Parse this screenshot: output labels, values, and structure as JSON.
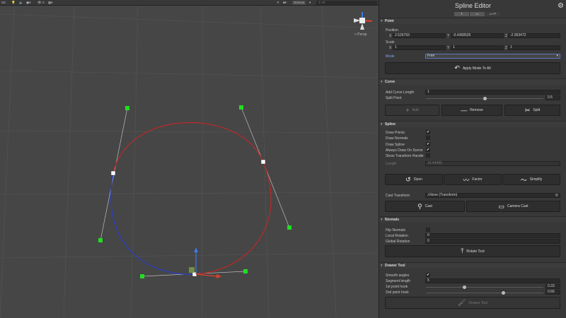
{
  "scene": {
    "toolbar": {
      "gizmos": "Gizmos",
      "search_placeholder": "All",
      "count": "0"
    },
    "persp": "< Persp"
  },
  "inspector": {
    "title": "Spline Editor",
    "tabs": [
      "T",
      "▭",
      "▭+T"
    ],
    "point": {
      "header": "Point",
      "position_label": "Position",
      "position": {
        "x": "2.526793",
        "y": "-0.4368526",
        "z": "-2.953472"
      },
      "scale_label": "Scale",
      "scale": {
        "x": "1",
        "y": "1",
        "z": "1"
      },
      "mode_label": "Mode",
      "mode_value": "Free",
      "apply_label": "Apply Mode To All"
    },
    "curve": {
      "header": "Curve",
      "add_length_label": "Add Curve Length",
      "add_length": "1",
      "split_label": "Split Point",
      "split_value": "0.5",
      "split_fraction": 0.5,
      "add": "Add",
      "remove": "Remove",
      "split": "Split"
    },
    "spline": {
      "header": "Spline",
      "checks": [
        {
          "label": "Draw Points",
          "checked": true
        },
        {
          "label": "Draw Normals",
          "checked": false
        },
        {
          "label": "Draw Spline",
          "checked": true
        },
        {
          "label": "Always Draw On Scene",
          "checked": true
        },
        {
          "label": "Show Transform Handle",
          "checked": false
        }
      ],
      "length_label": "Length",
      "length": "15.44495",
      "open": "Open",
      "factor": "Factor",
      "simplify": "Simplify",
      "cast_label": "Cast Transform",
      "cast_value": "None (Transform)",
      "cast": "Cast",
      "camera_cast": "Camera Cast"
    },
    "normals": {
      "header": "Normals",
      "flip_label": "Flip Normals",
      "local_label": "Local Rotation",
      "local": "0",
      "global_label": "Global Rotation",
      "global": "0",
      "rotate": "Rotate Tool"
    },
    "drawer": {
      "header": "Drawer Tool",
      "smooth_label": "Smooth angles",
      "segment_label": "Segment length",
      "segment": "5",
      "hook1_label": "1st point hook",
      "hook1": "0.33",
      "hook1_fraction": 0.33,
      "hook2_label": "2nd point hook",
      "hook2": "0.66",
      "hook2_fraction": 0.66,
      "drawer_button": "Drawer Tool"
    }
  },
  "colors": {
    "spline_red": "#b52a2a",
    "spline_blue": "#2a3fc4",
    "control_point": "#22dd22",
    "mode_label": "#7ea4e8"
  }
}
